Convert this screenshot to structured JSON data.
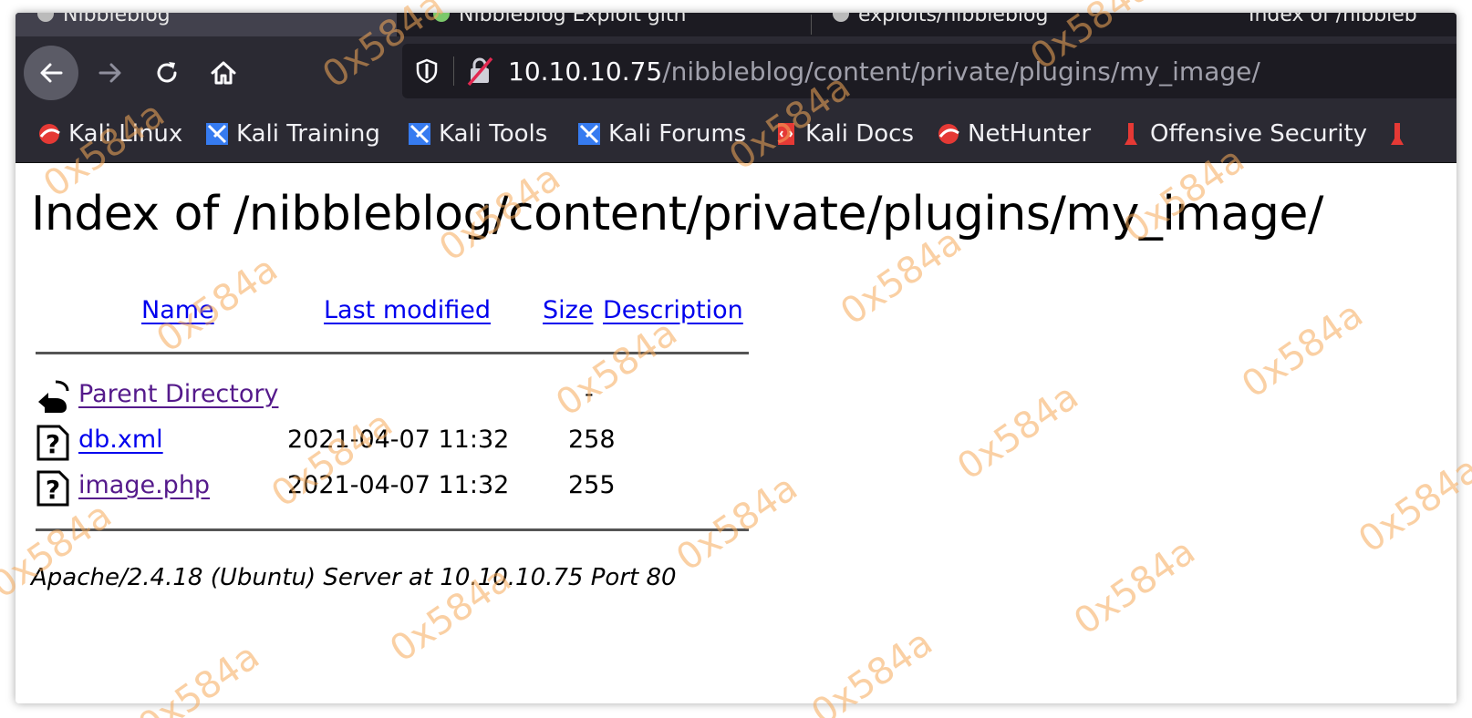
{
  "browser": {
    "tabs": [
      {
        "label": "Nibbleblog",
        "active": true
      },
      {
        "label": "Nibbleblog Exploit gith",
        "active": false
      },
      {
        "label": "exploits/nibbleblog",
        "active": false
      },
      {
        "label": "Index of /nibbleb",
        "active": false
      }
    ],
    "url": {
      "host": "10.10.10.75",
      "path": "/nibbleblog/content/private/plugins/my_image/"
    },
    "bookmarks": [
      {
        "label": "Kali Linux",
        "icon": "kali-linux-icon"
      },
      {
        "label": "Kali Training",
        "icon": "kali-training-icon"
      },
      {
        "label": "Kali Tools",
        "icon": "kali-tools-icon"
      },
      {
        "label": "Kali Forums",
        "icon": "kali-forums-icon"
      },
      {
        "label": "Kali Docs",
        "icon": "kali-docs-icon"
      },
      {
        "label": "NetHunter",
        "icon": "nethunter-icon"
      },
      {
        "label": "Offensive Security",
        "icon": "offsec-icon"
      }
    ]
  },
  "page": {
    "title": "Index of /nibbleblog/content/private/plugins/my_image/",
    "headers": {
      "name": "Name",
      "last_modified": "Last modified",
      "size": "Size",
      "description": "Description"
    },
    "rows": [
      {
        "name": "Parent Directory",
        "modified": "",
        "size": "-",
        "icon": "back-folder-icon"
      },
      {
        "name": "db.xml",
        "modified": "2021-04-07 11:32",
        "size": "258",
        "icon": "unknown-file-icon"
      },
      {
        "name": "image.php",
        "modified": "2021-04-07 11:32",
        "size": "255",
        "icon": "unknown-file-icon"
      }
    ],
    "footer": "Apache/2.4.18 (Ubuntu) Server at 10.10.10.75 Port 80"
  },
  "watermark": "0x584a",
  "colors": {
    "link": "#0000ee",
    "visited": "#551a8b",
    "toolbar": "#2b2a33",
    "watermark": "#f6aa5a"
  }
}
